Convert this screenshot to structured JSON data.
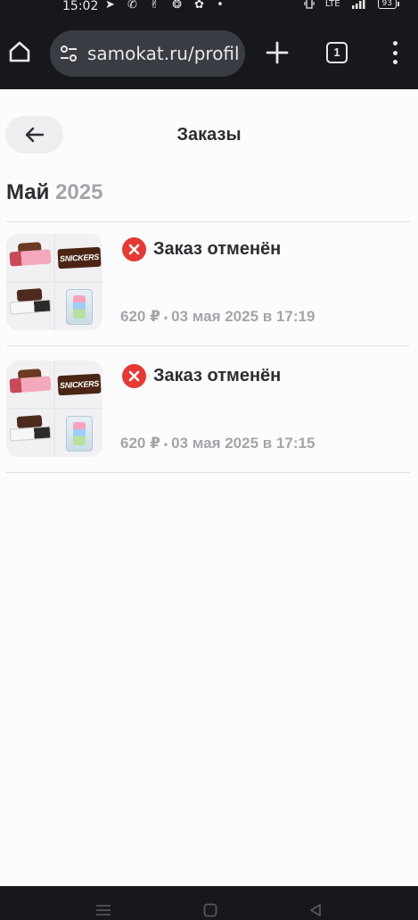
{
  "status_bar": {
    "time": "15:02",
    "notification_glyphs": "➤ ✆ ✌ ❂ ✿ •",
    "network": "LTE",
    "battery": "93"
  },
  "browser": {
    "url": "samokat.ru/profil",
    "tab_count": "1"
  },
  "page": {
    "title": "Заказы",
    "month": "Май",
    "year": "2025",
    "orders": [
      {
        "status": "Заказ отменён",
        "price": "620 ₽",
        "separator": "•",
        "date": "03 мая 2025 в 17:19",
        "thumb_label": "SNICKERS"
      },
      {
        "status": "Заказ отменён",
        "price": "620 ₽",
        "separator": "•",
        "date": "03 мая 2025 в 17:15",
        "thumb_label": "SNICKERS"
      }
    ]
  },
  "colors": {
    "cancel_red": "#e53935",
    "text_dark": "#2e2d33",
    "text_muted": "#a6a4ab",
    "chrome_dark": "#17181c"
  }
}
